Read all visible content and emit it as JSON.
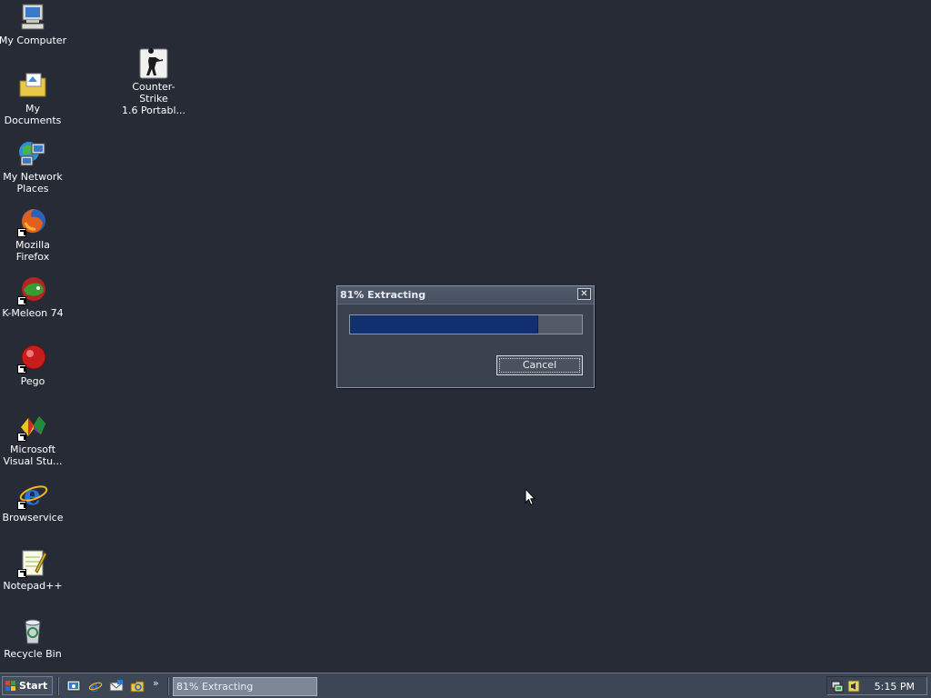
{
  "desktop": {
    "icons": [
      {
        "label": "My Computer",
        "icon": "my-computer-icon"
      },
      {
        "label": "My Documents",
        "icon": "my-documents-icon"
      },
      {
        "label": "My Network\nPlaces",
        "icon": "my-network-places-icon"
      },
      {
        "label": "Mozilla Firefox",
        "icon": "firefox-icon"
      },
      {
        "label": "K-Meleon 74",
        "icon": "k-meleon-icon"
      },
      {
        "label": "Pego",
        "icon": "pego-icon"
      },
      {
        "label": "Microsoft\nVisual Stu...",
        "icon": "visual-studio-icon"
      },
      {
        "label": "Browservice",
        "icon": "internet-explorer-icon"
      },
      {
        "label": "Notepad++",
        "icon": "notepad-plus-plus-icon"
      },
      {
        "label": "Recycle Bin",
        "icon": "recycle-bin-icon"
      },
      {
        "label": "Counter-Strike\n1.6 Portabl...",
        "icon": "counter-strike-icon"
      }
    ]
  },
  "dialog": {
    "title": "81% Extracting",
    "close_symbol": "✕",
    "progress": 0.81,
    "cancel_label": "Cancel"
  },
  "taskbar": {
    "start_label": "Start",
    "quicklaunch": [
      "show-desktop-icon",
      "internet-explorer-icon",
      "outlook-express-icon",
      "explorer-icon"
    ],
    "more_symbol": "»",
    "task_button_label": "81% Extracting",
    "clock": "5:15 PM",
    "tray_icons": [
      "network-icon",
      "volume-icon"
    ]
  },
  "colors": {
    "desktop_bg": "#262b35",
    "dialog_bg": "#3a4250",
    "progress_fill": "#10306f",
    "taskbar_bg": "#3c4655"
  }
}
